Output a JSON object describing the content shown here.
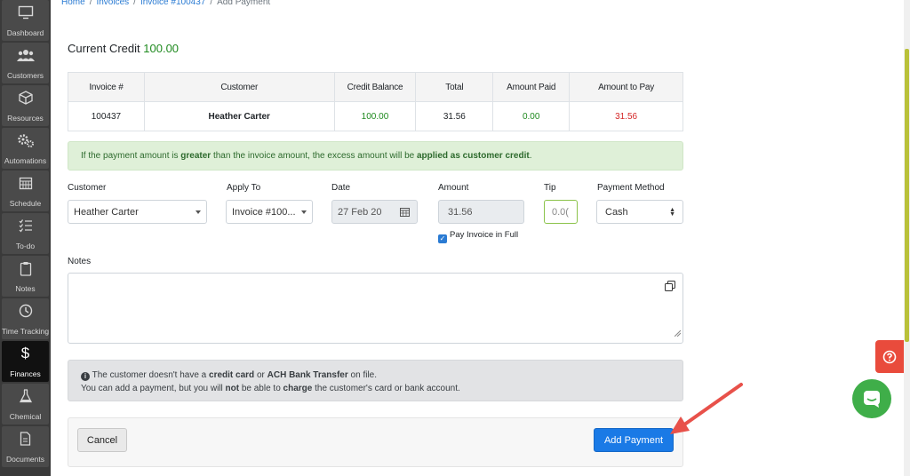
{
  "breadcrumb": {
    "home": "Home",
    "invoices": "Invoices",
    "invoice": "Invoice #100437",
    "current": "Add Payment",
    "sep": "/"
  },
  "sidebar": {
    "items": [
      {
        "label": "Dashboard",
        "icon": "monitor-icon"
      },
      {
        "label": "Customers",
        "icon": "users-icon"
      },
      {
        "label": "Resources",
        "icon": "cube-icon"
      },
      {
        "label": "Automations",
        "icon": "cogs-icon"
      },
      {
        "label": "Schedule",
        "icon": "calendar-icon"
      },
      {
        "label": "To-do",
        "icon": "checklist-icon"
      },
      {
        "label": "Notes",
        "icon": "clipboard-icon"
      },
      {
        "label": "Time Tracking",
        "icon": "clock-icon"
      },
      {
        "label": "Finances",
        "icon": "dollar-icon"
      },
      {
        "label": "Chemical",
        "icon": "flask-icon"
      },
      {
        "label": "Documents",
        "icon": "document-icon"
      }
    ]
  },
  "credit": {
    "label": "Current Credit",
    "value": "100.00"
  },
  "table": {
    "headers": [
      "Invoice #",
      "Customer",
      "Credit Balance",
      "Total",
      "Amount Paid",
      "Amount to Pay"
    ],
    "row": [
      "100437",
      "Heather Carter",
      "100.00",
      "31.56",
      "0.00",
      "31.56"
    ]
  },
  "alert_green": {
    "t1": "If the payment amount is ",
    "b1": "greater",
    "t2": " than the invoice amount, the excess amount will be ",
    "b2": "applied as customer credit",
    "t3": "."
  },
  "form": {
    "customer_label": "Customer",
    "customer_value": "Heather Carter",
    "apply_label": "Apply To",
    "apply_value": "Invoice #100...",
    "date_label": "Date",
    "date_value": "27 Feb 20",
    "amount_label": "Amount",
    "amount_value": "31.56",
    "tip_label": "Tip",
    "tip_value": "0.0(",
    "method_label": "Payment Method",
    "method_value": "Cash",
    "pay_full_label": "Pay Invoice in Full",
    "notes_label": "Notes"
  },
  "alert_grey": {
    "t1": " The customer doesn't have a ",
    "b1": "credit card",
    "t2": " or ",
    "b2": "ACH Bank Transfer",
    "t3": " on file.",
    "t4": "You can add a payment, but you will ",
    "b3": "not",
    "t5": " be able to ",
    "b4": "charge",
    "t6": " the customer's card or bank account."
  },
  "buttons": {
    "cancel": "Cancel",
    "add": "Add Payment"
  },
  "colors": {
    "accent": "#1a7ae6",
    "success": "#1f8a1f",
    "danger": "#d52828",
    "help": "#e94b3c",
    "chat": "#3fae49"
  }
}
